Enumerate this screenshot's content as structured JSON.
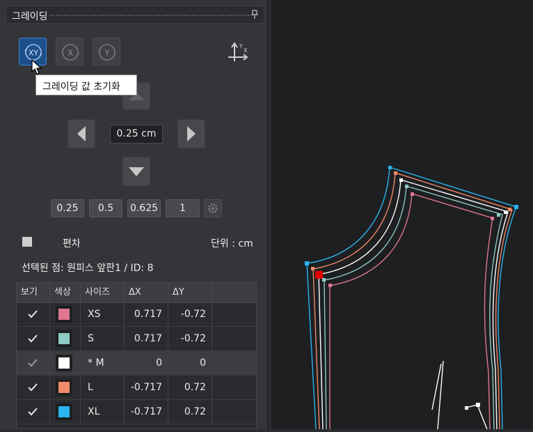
{
  "panel": {
    "title": "그레이딩",
    "toolbar": [
      {
        "name": "grade-xy-button",
        "label": "XY",
        "icon": "grade-xy-icon",
        "active": true
      },
      {
        "name": "grade-x-button",
        "label": "X",
        "icon": "grade-x-icon",
        "active": false
      },
      {
        "name": "grade-y-button",
        "label": "Y",
        "icon": "grade-y-icon",
        "active": false
      }
    ],
    "axis_icon": "axis-xy-icon",
    "tooltip": "그레이딩 값 초기화",
    "value": "0.25 cm",
    "step_values": [
      "0.25",
      "0.5",
      "0.625",
      "1"
    ],
    "deviation_label": "편차",
    "unit_label": "단위 : cm",
    "selected_point": "선택된 점: 원피스 앞판1 / ID: 8"
  },
  "table": {
    "headers": [
      "보기",
      "색상",
      "사이즈",
      "ΔX",
      "ΔY"
    ],
    "rows": [
      {
        "size": "XS",
        "dx": "0.717",
        "dy": "-0.72",
        "color": "#e0778f",
        "checked": true,
        "selected": false
      },
      {
        "size": "S",
        "dx": "0.717",
        "dy": "-0.72",
        "color": "#8fcac3",
        "checked": true,
        "selected": false
      },
      {
        "size": "* M",
        "dx": "0",
        "dy": "0",
        "color": "#ffffff",
        "checked": true,
        "selected": true
      },
      {
        "size": "L",
        "dx": "-0.717",
        "dy": "0.72",
        "color": "#f08a6a",
        "checked": true,
        "selected": false
      },
      {
        "size": "XL",
        "dx": "-0.717",
        "dy": "0.72",
        "color": "#2ab4f0",
        "checked": true,
        "selected": false
      }
    ]
  },
  "colors": {
    "accent": "#1f4f8a",
    "selected_point": "#e60000"
  }
}
